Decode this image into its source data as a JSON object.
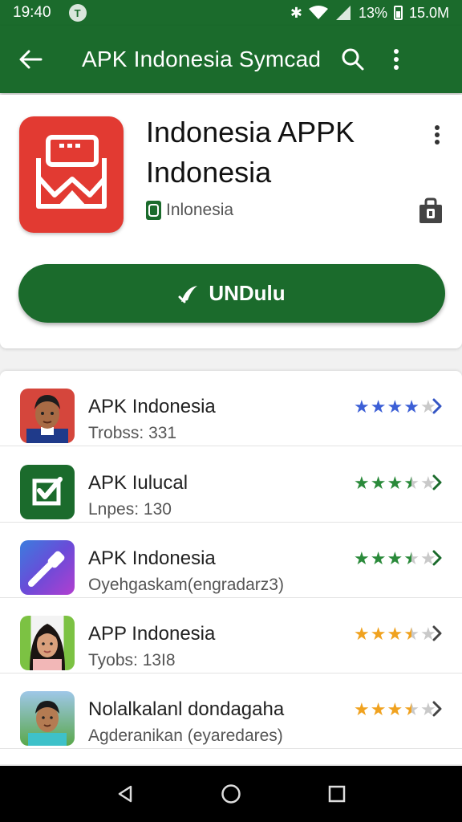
{
  "status_bar": {
    "time": "19:40",
    "notification_glyph": "T",
    "battery_text": "13%",
    "clock_right": "15.0M"
  },
  "app_bar": {
    "title": "APK Indonesia Symcad",
    "color": "#1b6b2c"
  },
  "app": {
    "name": "Indonesia APPK Indonesia",
    "developer": "Inlonesia",
    "download_label": "UNDulu",
    "icon_color": "#e23a32"
  },
  "list": [
    {
      "name": "APK Indonesia",
      "sub": "Trobss: 331",
      "rating": 4,
      "star_color": "#3c5fd6",
      "thumb": "person-avatar"
    },
    {
      "name": "APK Iulucal",
      "sub": "Lnpes: 130",
      "rating": 3.5,
      "star_color": "#2a8a3a",
      "thumb": "checkbox-app-icon"
    },
    {
      "name": "APK Indonesia",
      "sub": "Oyehgaskam(engradarz3)",
      "rating": 3.5,
      "star_color": "#2a8a3a",
      "thumb": "pipette-app-icon"
    },
    {
      "name": "APP Indonesia",
      "sub": "Tyobs: 13I8",
      "rating": 3.5,
      "star_color": "#f0a21f",
      "thumb": "person-avatar"
    },
    {
      "name": "Nolalkalanl dondagaha",
      "sub": "Agderanikan (eyaredares)",
      "rating": 3.5,
      "star_color": "#f0a21f",
      "thumb": "person-avatar"
    }
  ]
}
